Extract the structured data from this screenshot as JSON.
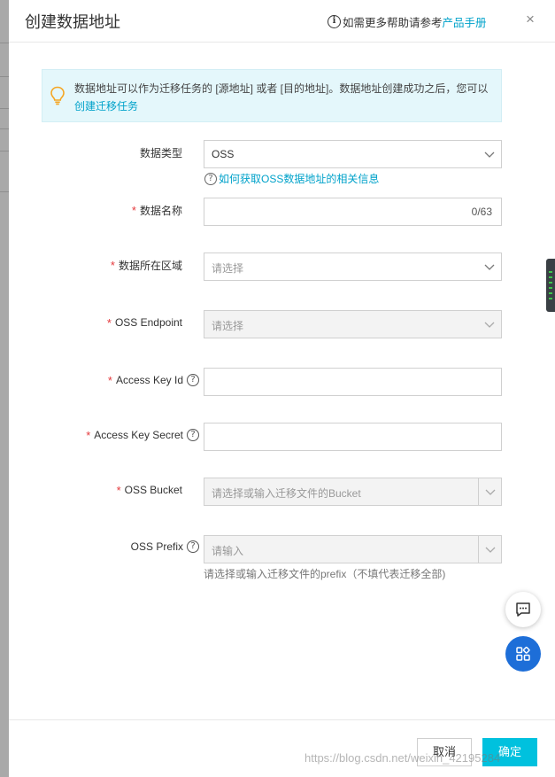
{
  "header": {
    "title": "创建数据地址",
    "help_text": "如需更多帮助请参考",
    "help_link": "产品手册",
    "close": "×"
  },
  "notice": {
    "text": "数据地址可以作为迁移任务的 [源地址] 或者 [目的地址]。数据地址创建成功之后，您可以",
    "link": "创建迁移任务"
  },
  "form": {
    "data_type": {
      "label": "数据类型",
      "value": "OSS"
    },
    "data_type_hint": "如何获取OSS数据地址的相关信息",
    "data_name": {
      "label": "数据名称",
      "counter": "0/63"
    },
    "region": {
      "label": "数据所在区域",
      "placeholder": "请选择"
    },
    "endpoint": {
      "label": "OSS Endpoint",
      "placeholder": "请选择"
    },
    "access_key_id": {
      "label": "Access Key Id"
    },
    "access_key_secret": {
      "label": "Access Key Secret"
    },
    "bucket": {
      "label": "OSS Bucket",
      "placeholder": "请选择或输入迁移文件的Bucket"
    },
    "prefix": {
      "label": "OSS Prefix",
      "placeholder": "请输入",
      "note": "请选择或输入迁移文件的prefix（不填代表迁移全部)"
    }
  },
  "footer": {
    "cancel": "取消",
    "ok": "确定"
  },
  "watermark": "https://blog.csdn.net/weixin_42195284",
  "colors": {
    "accent": "#00c1de",
    "link": "#00a2ca",
    "required": "#e4393c",
    "float_apps": "#1d6ed8"
  }
}
